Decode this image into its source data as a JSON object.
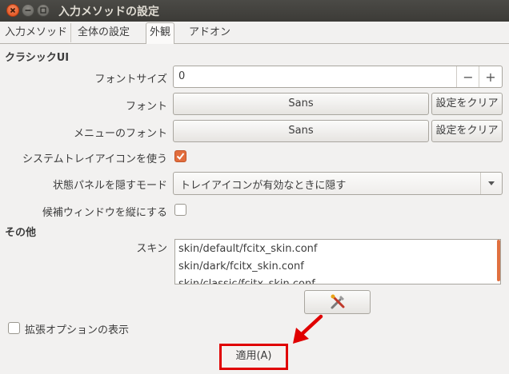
{
  "window": {
    "title": "入力メソッドの設定"
  },
  "tabs": [
    {
      "label": "入力メソッド"
    },
    {
      "label": "全体の設定"
    },
    {
      "label": "外観"
    },
    {
      "label": "アドオン"
    }
  ],
  "classic": {
    "heading": "クラシックUI",
    "font_size": {
      "label": "フォントサイズ",
      "value": "0",
      "minus": "−",
      "plus": "+"
    },
    "font": {
      "label": "フォント",
      "value": "Sans",
      "clear": "設定をクリア"
    },
    "menu_font": {
      "label": "メニューのフォント",
      "value": "Sans",
      "clear": "設定をクリア"
    },
    "tray_icon": {
      "label": "システムトレイアイコンを使う",
      "checked": true
    },
    "hide_mode": {
      "label": "状態パネルを隠すモード",
      "value": "トレイアイコンが有効なときに隠す"
    },
    "vertical": {
      "label": "候補ウィンドウを縦にする",
      "checked": false
    }
  },
  "other": {
    "heading": "その他",
    "skin": {
      "label": "スキン",
      "items": [
        "skin/default/fcitx_skin.conf",
        "skin/dark/fcitx_skin.conf",
        "skin/classic/fcitx_skin.conf"
      ]
    },
    "tool_button_icon": "tools-icon"
  },
  "advanced": {
    "label": "拡張オプションの表示",
    "checked": false
  },
  "apply": {
    "label": "適用(A)"
  },
  "colors": {
    "accent": "#e26d3d",
    "highlight": "#e00000"
  }
}
